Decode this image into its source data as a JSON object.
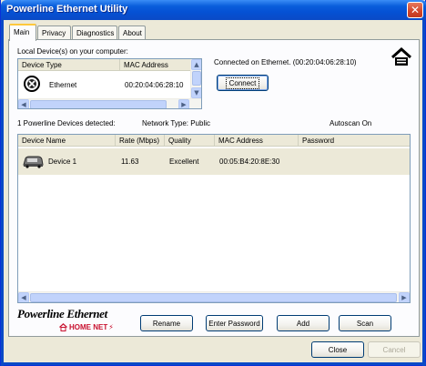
{
  "window": {
    "title": "Powerline Ethernet Utility"
  },
  "tabs": [
    {
      "label": "Main"
    },
    {
      "label": "Privacy"
    },
    {
      "label": "Diagnostics"
    },
    {
      "label": "About"
    }
  ],
  "local": {
    "group_label": "Local Device(s) on your computer:",
    "columns": [
      "Device Type",
      "MAC Address"
    ],
    "rows": [
      {
        "type": "Ethernet",
        "mac": "00:20:04:06:28:10"
      }
    ],
    "status": "Connected on Ethernet. (00:20:04:06:28:10)",
    "connect_label": "Connect"
  },
  "summary": {
    "detected": "1 Powerline Devices detected:",
    "network_type": "Network Type: Public",
    "autoscan": "Autoscan On"
  },
  "devices": {
    "columns": [
      "Device Name",
      "Rate (Mbps)",
      "Quality",
      "MAC Address",
      "Password"
    ],
    "rows": [
      {
        "name": "Device 1",
        "rate": "11.63",
        "quality": "Excellent",
        "mac": "00:05:B4:20:8E:30",
        "password": ""
      }
    ]
  },
  "logo": {
    "line1": "Powerline Ethernet",
    "line2": "HOME NET"
  },
  "actions": {
    "rename": "Rename",
    "enter_password": "Enter Password",
    "add": "Add",
    "scan": "Scan"
  },
  "footer": {
    "close": "Close",
    "cancel": "Cancel"
  },
  "colors": {
    "title_bar": "#0A5EDB",
    "row_selected": "#ECE9D8",
    "logo_red": "#C8102E"
  }
}
